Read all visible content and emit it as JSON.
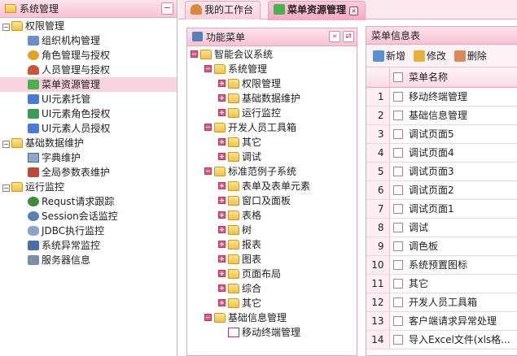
{
  "colors": {
    "accent": "#f5a9c1",
    "header": "#f8c3d4",
    "border": "#e7a6bb",
    "selected": "#f9d3df"
  },
  "left": {
    "title": "系统管理",
    "collapse": "−",
    "groups": [
      {
        "label": "权限管理",
        "items": [
          "组织机构管理",
          "角色管理与授权",
          "人员管理与授权",
          "菜单资源管理",
          "UI元素托管",
          "UI元素角色授权",
          "UI元素人员授权"
        ]
      },
      {
        "label": "基础数据维护",
        "items": [
          "字典维护",
          "全局参数表维护"
        ]
      },
      {
        "label": "运行监控",
        "items": [
          "Requst请求跟踪",
          "Session会话监控",
          "JDBC执行监控",
          "系统异常监控",
          "服务器信息"
        ]
      }
    ]
  },
  "tabs": [
    {
      "label": "我的工作台",
      "icon": "user-icon"
    },
    {
      "label": "菜单资源管理",
      "icon": "menu-resource-icon",
      "close": "×"
    }
  ],
  "func": {
    "title": "功能菜单",
    "btn1": "«",
    "btn2": "⇄",
    "root": "智能会议系统",
    "nodes": [
      {
        "label": "系统管理",
        "children": [
          "权限管理",
          "基础数据维护",
          "运行监控"
        ]
      },
      {
        "label": "开发人员工具箱",
        "children": [
          "其它",
          "调试"
        ]
      },
      {
        "label": "标准范例子系统",
        "children": [
          "表单及表单元素",
          "窗口及面板",
          "表格",
          "树",
          "报表",
          "图表",
          "页面布局",
          "综合",
          "其它"
        ]
      },
      {
        "label": "基础信息管理",
        "leaf": "移动终端管理"
      }
    ]
  },
  "info": {
    "title": "菜单信息表",
    "toolbar": {
      "add": "新增",
      "edit": "修改",
      "del": "删除"
    },
    "col": "菜单名称",
    "rows": [
      {
        "n": "1",
        "name": "移动终端管理"
      },
      {
        "n": "2",
        "name": "基础信息管理"
      },
      {
        "n": "3",
        "name": "调试页面5"
      },
      {
        "n": "4",
        "name": "调试页面4"
      },
      {
        "n": "5",
        "name": "调试页面3"
      },
      {
        "n": "6",
        "name": "调试页面2"
      },
      {
        "n": "7",
        "name": "调试页面1"
      },
      {
        "n": "8",
        "name": "调试"
      },
      {
        "n": "9",
        "name": "调色板"
      },
      {
        "n": "10",
        "name": "系统预置图标"
      },
      {
        "n": "11",
        "name": "其它"
      },
      {
        "n": "12",
        "name": "开发人员工具箱"
      },
      {
        "n": "13",
        "name": "客户端请求异常处理"
      },
      {
        "n": "14",
        "name": "导入Excel文件(xls格..."
      }
    ]
  }
}
